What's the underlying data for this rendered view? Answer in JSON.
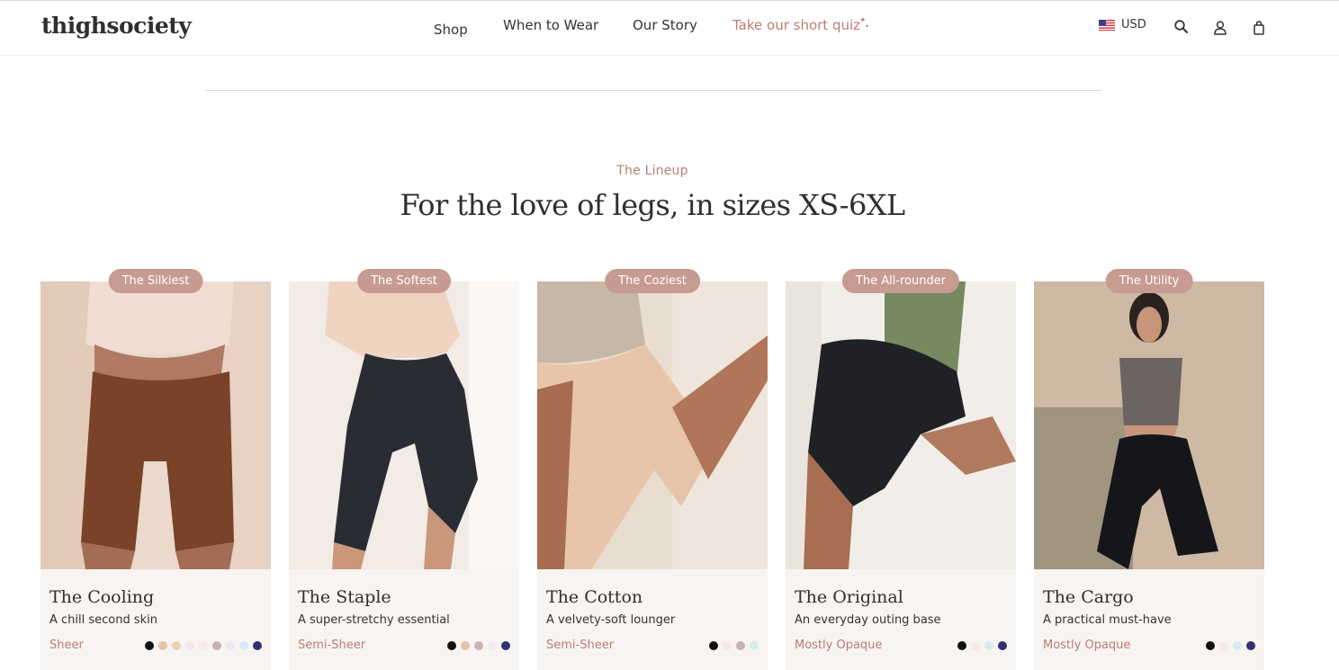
{
  "header": {
    "logo": "thighsociety",
    "nav": {
      "shop": "Shop",
      "when_to_wear": "When to Wear",
      "our_story": "Our Story",
      "quiz": "Take our short quiz"
    },
    "currency": "USD",
    "icons": [
      "us-flag-icon",
      "search-icon",
      "account-icon",
      "cart-icon"
    ]
  },
  "section": {
    "eyebrow": "The Lineup",
    "headline": "For the love of legs, in sizes XS-6XL"
  },
  "products": [
    {
      "badge": "The Silkiest",
      "name": "The Cooling",
      "desc": "A chill second skin",
      "opacity": "Sheer",
      "swatches": [
        "#111111",
        "#e4c2a6",
        "#ecd2b3",
        "#f3e6e8",
        "#f5ecec",
        "#cbb1b6",
        "#ede6f3",
        "#d8ebf1",
        "#2e3270"
      ]
    },
    {
      "badge": "The Softest",
      "name": "The Staple",
      "desc": "A super-stretchy essential",
      "opacity": "Semi-Sheer",
      "swatches": [
        "#111111",
        "#e4c2a6",
        "#cbb1b6",
        "#f3e9f2",
        "#2e3270"
      ]
    },
    {
      "badge": "The Coziest",
      "name": "The Cotton",
      "desc": "A velvety-soft lounger",
      "opacity": "Semi-Sheer",
      "swatches": [
        "#111111",
        "#f3e9ea",
        "#cbb1b6",
        "#d8ebf1"
      ]
    },
    {
      "badge": "The All-rounder",
      "name": "The Original",
      "desc": "An everyday outing base",
      "opacity": "Mostly Opaque",
      "swatches": [
        "#111111",
        "#f3e9ea",
        "#d8ebf1",
        "#2e3270"
      ]
    },
    {
      "badge": "The Utility",
      "name": "The Cargo",
      "desc": "A practical must-have",
      "opacity": "Mostly Opaque",
      "swatches": [
        "#111111",
        "#f3e9ea",
        "#d8ebf1",
        "#2e3270"
      ]
    }
  ],
  "colors": {
    "accent": "#b97d72",
    "badge": "#c79b91",
    "card_bg": "#f8f4f2",
    "text": "#2f2f2f"
  }
}
